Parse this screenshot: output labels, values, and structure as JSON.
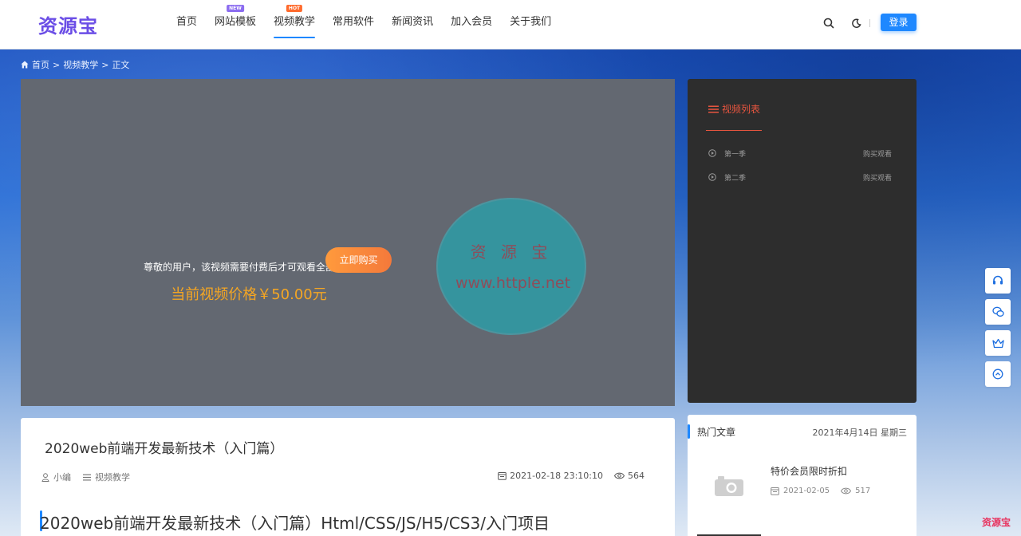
{
  "header": {
    "logo": "资源宝",
    "nav": [
      {
        "label": "首页",
        "badge": ""
      },
      {
        "label": "网站模板",
        "badge": "NEW"
      },
      {
        "label": "视频教学",
        "badge": "HOT"
      },
      {
        "label": "常用软件",
        "badge": ""
      },
      {
        "label": "新闻资讯",
        "badge": ""
      },
      {
        "label": "加入会员",
        "badge": ""
      },
      {
        "label": "关于我们",
        "badge": ""
      }
    ],
    "active_nav": "视频教学",
    "login_label": "登录"
  },
  "breadcrumb": {
    "home": "首页",
    "sep": ">",
    "category": "视频教学",
    "current": "正文"
  },
  "video": {
    "pay_tip": "尊敬的用户，该视频需要付费后才可观看全部内容",
    "price_text": "当前视频价格￥50.00元",
    "buy_label": "立即购买",
    "watermark_name": "资 源 宝",
    "watermark_url": "www.httple.net"
  },
  "video_list": {
    "title": "视频列表",
    "items": [
      {
        "label": "第一季",
        "action": "购买观看"
      },
      {
        "label": "第二季",
        "action": "购买观看"
      }
    ]
  },
  "article": {
    "title": "2020web前端开发最新技术（入门篇）",
    "author": "小编",
    "category": "视频教学",
    "datetime": "2021-02-18 23:10:10",
    "views": "564",
    "heading": "2020web前端开发最新技术（入门篇）Html/CSS/JS/H5/CS3/入门项目"
  },
  "hot_articles": {
    "title": "热门文章",
    "date": "2021年4月14日 星期三",
    "items": [
      {
        "title": "特价会员限时折扣",
        "date": "2021-02-05",
        "views": "517"
      }
    ]
  },
  "corner_brand": "资源宝",
  "colors": {
    "accent": "#1e88ff",
    "price": "#f5a623",
    "list_title": "#e8553f",
    "logo": "#6b4ee6"
  }
}
